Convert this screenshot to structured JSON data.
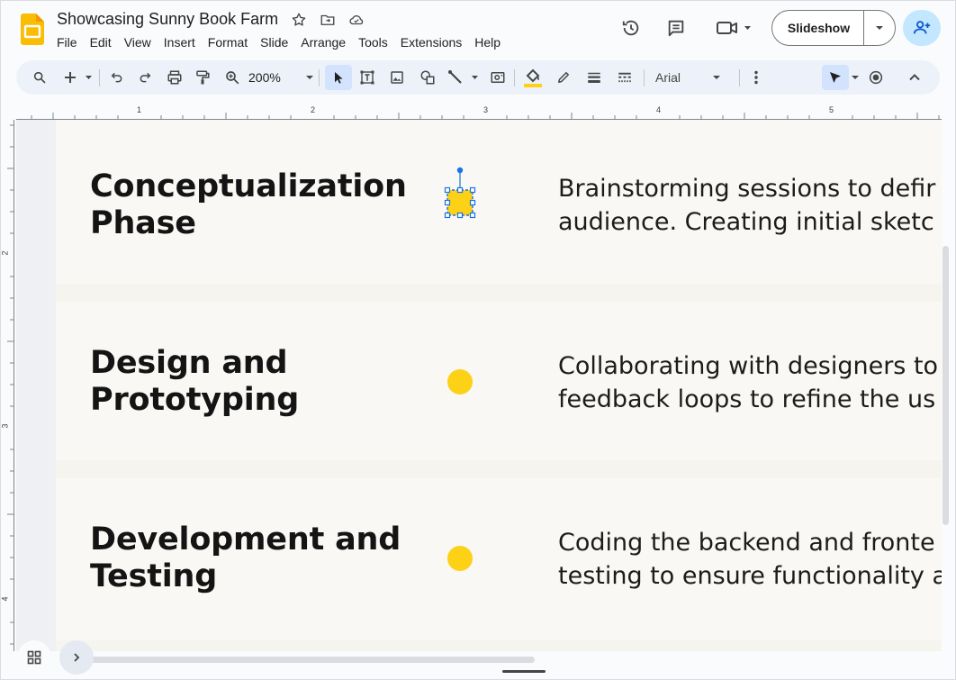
{
  "app": {
    "title": "Showcasing Sunny Book Farm",
    "menu": [
      "File",
      "Edit",
      "View",
      "Insert",
      "Format",
      "Slide",
      "Arrange",
      "Tools",
      "Extensions",
      "Help"
    ],
    "slideshow_label": "Slideshow",
    "icons": {
      "logo": "slides-logo-icon",
      "star": "star-icon",
      "move": "move-to-folder-icon",
      "cloud": "cloud-saved-icon",
      "history": "version-history-icon",
      "comments": "comments-icon",
      "meet": "video-call-icon",
      "share": "add-person-icon"
    },
    "accent_color": "#0b57d0",
    "brand_color": "#fbbc04"
  },
  "toolbar": {
    "zoom": "200%",
    "font": "Arial",
    "fill_color": "#fcd116"
  },
  "ruler": {
    "top_numbers": [
      "1",
      "2",
      "3",
      "4",
      "5"
    ],
    "left_numbers": [
      "2",
      "3",
      "4"
    ]
  },
  "slide": {
    "phases": [
      {
        "title": "Conceptualization Phase",
        "description_lines": [
          "Brainstorming sessions to defir",
          "audience. Creating initial sketc"
        ]
      },
      {
        "title": "Design and Prototyping",
        "description_lines": [
          "Collaborating with designers to",
          "feedback loops to refine the us"
        ]
      },
      {
        "title": "Development and Testing",
        "description_lines": [
          "Coding the backend and fronte",
          "testing to ensure functionality a"
        ]
      }
    ],
    "dot_color": "#fcd116",
    "selection_color": "#1a73e8"
  }
}
